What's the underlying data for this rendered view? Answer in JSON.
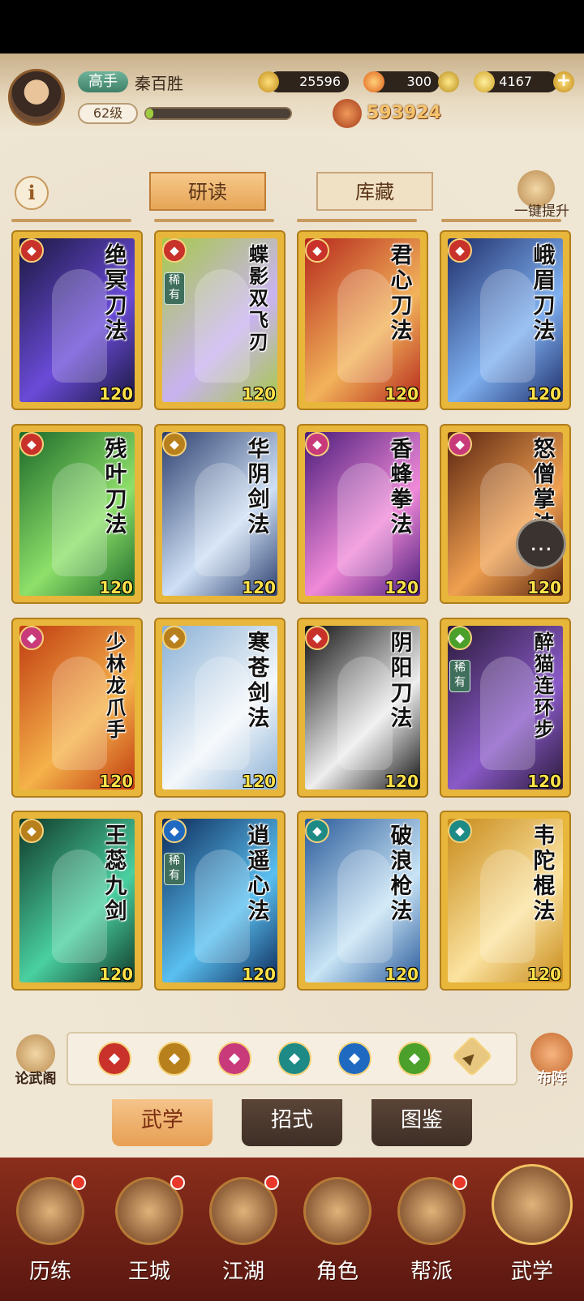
{
  "player": {
    "rank": "高手",
    "name": "秦百胜",
    "level": "62级",
    "exp_fraction": 0.05,
    "power": "593924"
  },
  "resources": {
    "coins": "25596",
    "fire": "300",
    "gold": "4167"
  },
  "tabs": {
    "study": "研读",
    "storage": "库藏"
  },
  "one_click": "一键提升",
  "cards": [
    {
      "name": "绝冥刀法",
      "level": "120",
      "rare": "",
      "badge": "red-blade",
      "art": [
        "#1b1840",
        "#6a4bd8"
      ]
    },
    {
      "name": "蝶影双飞刃",
      "level": "120",
      "rare": "稀有",
      "badge": "red-blade",
      "art": [
        "#a7c94a",
        "#c9b3f0"
      ]
    },
    {
      "name": "君心刀法",
      "level": "120",
      "rare": "",
      "badge": "red-blade",
      "art": [
        "#b5281c",
        "#f2b35a"
      ]
    },
    {
      "name": "峨眉刀法",
      "level": "120",
      "rare": "",
      "badge": "red-blade",
      "art": [
        "#1f2e6a",
        "#7fb0f0"
      ]
    },
    {
      "name": "残叶刀法",
      "level": "120",
      "rare": "",
      "badge": "red-blade",
      "art": [
        "#1d6a2a",
        "#8ee06a"
      ]
    },
    {
      "name": "华阴剑法",
      "level": "120",
      "rare": "",
      "badge": "gold-sword",
      "art": [
        "#2c3f6e",
        "#cfe0f5"
      ]
    },
    {
      "name": "香蜂拳法",
      "level": "120",
      "rare": "",
      "badge": "pink-fist",
      "art": [
        "#4a1c7a",
        "#f08ad8"
      ]
    },
    {
      "name": "怒僧掌法",
      "level": "120",
      "rare": "",
      "badge": "pink-fist",
      "art": [
        "#5a2410",
        "#f0a050"
      ]
    },
    {
      "name": "少林龙爪手",
      "level": "120",
      "rare": "",
      "badge": "pink-fist",
      "art": [
        "#c03a10",
        "#f5b24a"
      ]
    },
    {
      "name": "寒苍剑法",
      "level": "120",
      "rare": "",
      "badge": "gold-sword",
      "art": [
        "#8ab0d5",
        "#f4f8fb"
      ]
    },
    {
      "name": "阴阳刀法",
      "level": "120",
      "rare": "",
      "badge": "red-blade",
      "art": [
        "#111111",
        "#eeeeee"
      ]
    },
    {
      "name": "醉猫连环步",
      "level": "120",
      "rare": "稀有",
      "badge": "green-swirl",
      "art": [
        "#2a1a3a",
        "#8a5ac8"
      ]
    },
    {
      "name": "王蕊九剑",
      "level": "120",
      "rare": "",
      "badge": "gold-sword",
      "art": [
        "#0f3a2a",
        "#4ad0a0"
      ]
    },
    {
      "name": "逍遥心法",
      "level": "120",
      "rare": "稀有",
      "badge": "blue-yinyang",
      "art": [
        "#0c2a5a",
        "#5ac0f0"
      ]
    },
    {
      "name": "破浪枪法",
      "level": "120",
      "rare": "",
      "badge": "teal-fan",
      "art": [
        "#2a5a9a",
        "#c8e4f5"
      ]
    },
    {
      "name": "韦陀棍法",
      "level": "120",
      "rare": "",
      "badge": "teal-fan",
      "art": [
        "#c88a1a",
        "#fbe3a0"
      ]
    }
  ],
  "filters": [
    {
      "icon": "red-blade-icon",
      "color": "#c8322a"
    },
    {
      "icon": "gold-sword-icon",
      "color": "#b8801c"
    },
    {
      "icon": "pink-fist-icon",
      "color": "#c83a7a"
    },
    {
      "icon": "teal-fan-icon",
      "color": "#1e8a86"
    },
    {
      "icon": "blue-yinyang-icon",
      "color": "#1f6ac0"
    },
    {
      "icon": "green-swirl-icon",
      "color": "#4aa02a"
    },
    {
      "icon": "gold-arrow-icon",
      "color": "#e8c880"
    }
  ],
  "side_buttons": {
    "lunwu": "论武阁",
    "buzhen": "布阵"
  },
  "lower_tabs": {
    "wuxue": "武学",
    "zhaoshi": "招式",
    "tujian": "图鉴"
  },
  "nav": {
    "lilian": "历练",
    "wangcheng": "王城",
    "jianghu": "江湖",
    "jiaose": "角色",
    "bangpai": "帮派",
    "wuxue": "武学"
  }
}
